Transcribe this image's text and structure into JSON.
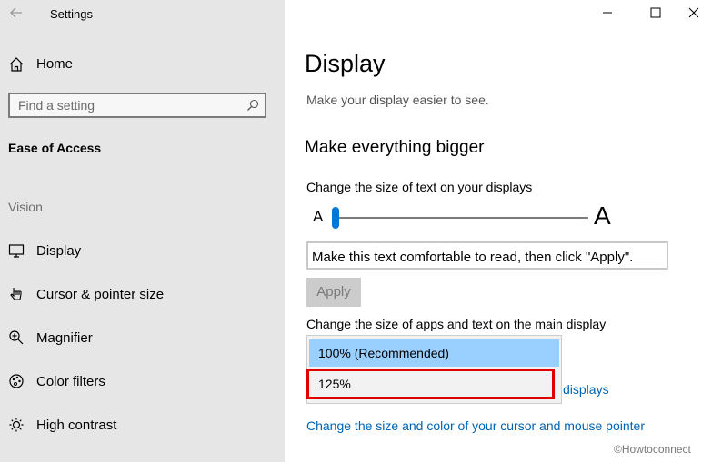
{
  "window": {
    "title": "Settings",
    "controls": [
      "minimize-icon",
      "maximize-icon",
      "close-icon"
    ]
  },
  "sidebar": {
    "home_label": "Home",
    "search": {
      "placeholder": "Find a setting",
      "value": ""
    },
    "section_title": "Ease of Access",
    "group_label": "Vision",
    "items": [
      {
        "label": "Display",
        "icon": "monitor-icon"
      },
      {
        "label": "Cursor & pointer size",
        "icon": "cursor-icon"
      },
      {
        "label": "Magnifier",
        "icon": "magnifier-icon"
      },
      {
        "label": "Color filters",
        "icon": "color-filters-icon"
      },
      {
        "label": "High contrast",
        "icon": "high-contrast-icon"
      }
    ]
  },
  "main": {
    "page_title": "Display",
    "subtitle": "Make your display easier to see.",
    "section_heading": "Make everything bigger",
    "text_size_label": "Change the size of text on your displays",
    "slider": {
      "min_label": "A",
      "max_label": "A",
      "value_fraction": 0.0
    },
    "preview_text": "Make this text comfortable to read, then click \"Apply\".",
    "apply_label": "Apply",
    "scale_label": "Change the size of apps and text on the main display",
    "scale_options": [
      "100% (Recommended)",
      "125%"
    ],
    "scale_selected": "100% (Recommended)",
    "other_displays_link_partial": "displays",
    "cursor_link": "Change the size and color of your cursor and mouse pointer"
  },
  "watermark": "©Howtoconnect",
  "colors": {
    "accent": "#0078d7",
    "link": "#0063b1",
    "selected_option": "#99d0ff",
    "highlight_border": "#e00000",
    "sidebar_bg": "#e6e6e6"
  }
}
